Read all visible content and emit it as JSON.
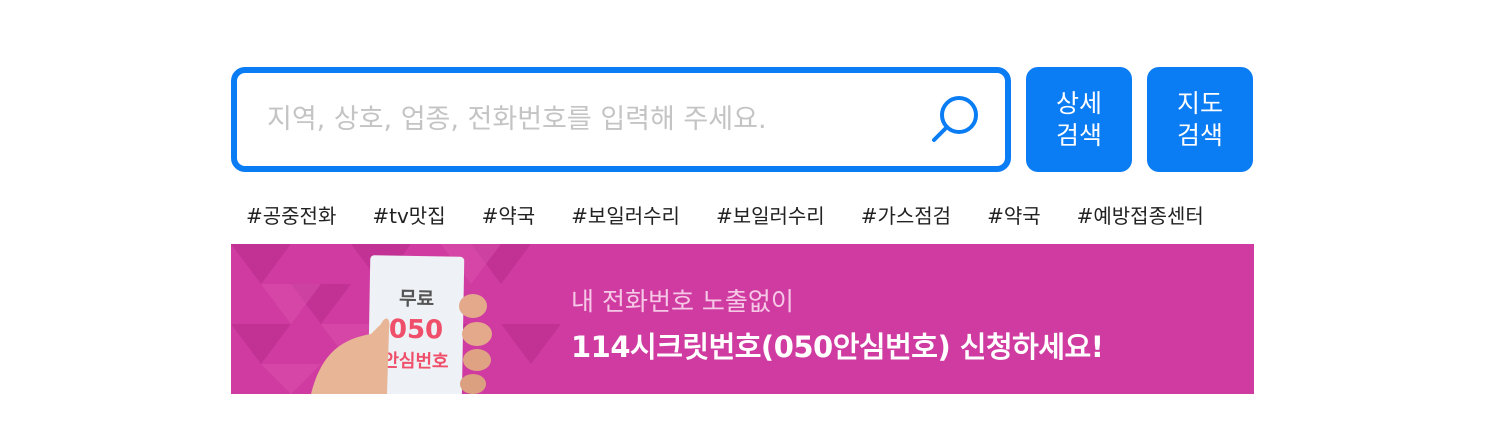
{
  "search": {
    "placeholder": "지역, 상호, 업종, 전화번호를 입력해 주세요.",
    "value": ""
  },
  "buttons": {
    "detail_line1": "상세",
    "detail_line2": "검색",
    "map_line1": "지도",
    "map_line2": "검색"
  },
  "tags": [
    "#공중전화",
    "#tv맛집",
    "#약국",
    "#보일러수리",
    "#보일러수리",
    "#가스점검",
    "#약국",
    "#예방접종센터"
  ],
  "banner": {
    "card_line1": "무료",
    "card_line2": "050",
    "card_line3": "안심번호",
    "subtitle": "내 전화번호 노출없이",
    "title": "114시크릿번호(050안심번호) 신청하세요!"
  },
  "colors": {
    "accent": "#0a7cf4",
    "banner_bg": "#d03ba1",
    "card_text": "#ef4f6a"
  },
  "icons": {
    "search": "search-icon"
  }
}
